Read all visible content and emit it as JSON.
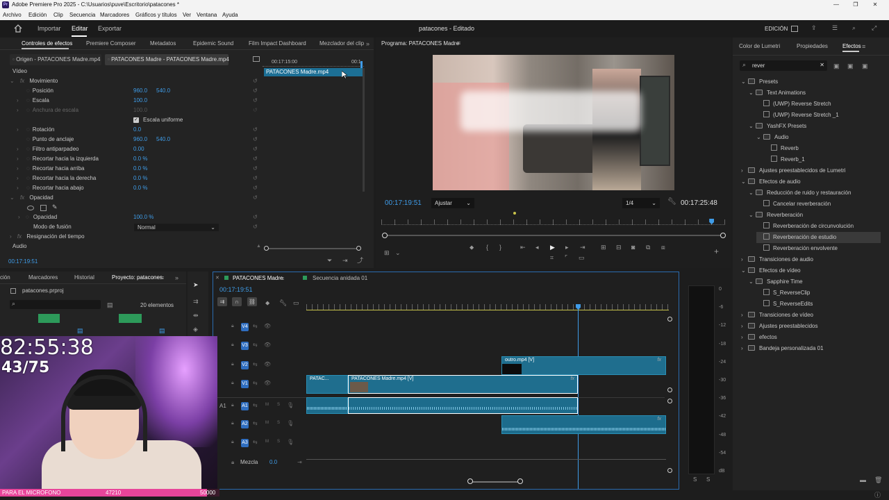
{
  "window": {
    "title": "Adobe Premiere Pro 2025 - C:\\Usuarios\\puve\\Escritorio\\patacones *",
    "controls": [
      "—",
      "❐",
      "✕"
    ]
  },
  "menu": [
    "Archivo",
    "Edición",
    "Clip",
    "Secuencia",
    "Marcadores",
    "Gráficos y títulos",
    "Ver",
    "Ventana",
    "Ayuda"
  ],
  "header": {
    "tabs": [
      "Importar",
      "Editar",
      "Exportar"
    ],
    "active_tab": "Editar",
    "project_title": "patacones - Editado",
    "workspace": "EDICIÓN"
  },
  "effect_controls": {
    "tabs": [
      "Controles de efectos",
      "Premiere Composer",
      "Metadatos",
      "Epidemic Sound",
      "Film Impact Dashboard",
      "Mezclador del clip"
    ],
    "source_tab": "Origen - PATACONES Madre.mp4",
    "clip_tab": "PATACONES Madre - PATACONES Madre.mp4",
    "timecode_ruler": "00:17:15:00",
    "ruler_end": "00:1",
    "clip_label": "PATACONES Madre.mp4",
    "video_header": "Vídeo",
    "movimiento": "Movimiento",
    "props": [
      {
        "name": "Posición",
        "v1": "960.0",
        "v2": "540.0",
        "expand": false
      },
      {
        "name": "Escala",
        "v1": "100.0",
        "v2": "",
        "expand": true
      },
      {
        "name": "Anchura de escala",
        "v1": "100.0",
        "v2": "",
        "expand": true,
        "disabled": true
      },
      {
        "name": "Rotación",
        "v1": "0.0",
        "v2": "",
        "expand": true
      },
      {
        "name": "Punto de anclaje",
        "v1": "960.0",
        "v2": "540.0",
        "expand": false
      },
      {
        "name": "Filtro antiparpadeo",
        "v1": "0.00",
        "v2": "",
        "expand": true
      },
      {
        "name": "Recortar hacia la izquierda",
        "v1": "0.0 %",
        "v2": "",
        "expand": true
      },
      {
        "name": "Recortar hacia arriba",
        "v1": "0.0 %",
        "v2": "",
        "expand": true
      },
      {
        "name": "Recortar hacia la derecha",
        "v1": "0.0 %",
        "v2": "",
        "expand": true
      },
      {
        "name": "Recortar hacia abajo",
        "v1": "0.0 %",
        "v2": "",
        "expand": true
      }
    ],
    "uniform_scale": "Escala uniforme",
    "opacidad_header": "Opacidad",
    "opacidad_label": "Opacidad",
    "opacidad_value": "100.0 %",
    "blend_label": "Modo de fusión",
    "blend_value": "Normal",
    "time_remap": "Resignación del tiempo",
    "audio_header": "Audio",
    "timecode": "00:17:19:51"
  },
  "program": {
    "title": "Programa: PATACONES Madre",
    "timecode": "00:17:19:51",
    "fit": "Ajustar",
    "resolution": "1/4",
    "duration": "00:17:25:48",
    "playhead_pct": 0.96
  },
  "right_panel": {
    "tabs": [
      "Color de Lumetri",
      "Propiedades",
      "Efectos"
    ],
    "search_value": "rever",
    "tree": [
      {
        "depth": 0,
        "type": "folder",
        "open": true,
        "label": "Presets"
      },
      {
        "depth": 1,
        "type": "folder",
        "open": true,
        "label": "Text Animations"
      },
      {
        "depth": 2,
        "type": "preset",
        "label": "(UWP) Reverse Stretch"
      },
      {
        "depth": 2,
        "type": "preset",
        "label": "(UWP) Reverse Stretch _1"
      },
      {
        "depth": 1,
        "type": "folder",
        "open": true,
        "label": "YashFX Presets"
      },
      {
        "depth": 2,
        "type": "folder",
        "open": true,
        "label": "Audio"
      },
      {
        "depth": 3,
        "type": "preset",
        "label": "Reverb"
      },
      {
        "depth": 3,
        "type": "preset",
        "label": "Reverb_1"
      },
      {
        "depth": 0,
        "type": "folder",
        "open": false,
        "label": "Ajustes preestablecidos de Lumetri"
      },
      {
        "depth": 0,
        "type": "folder",
        "open": true,
        "label": "Efectos de audio"
      },
      {
        "depth": 1,
        "type": "folder",
        "open": true,
        "label": "Reducción de ruido y restauración"
      },
      {
        "depth": 2,
        "type": "preset",
        "label": "Cancelar reverberación"
      },
      {
        "depth": 1,
        "type": "folder",
        "open": true,
        "label": "Reverberación"
      },
      {
        "depth": 2,
        "type": "preset",
        "label": "Reverberación de circunvolución"
      },
      {
        "depth": 2,
        "type": "preset",
        "label": "Reverberación de estudio",
        "selected": true
      },
      {
        "depth": 2,
        "type": "preset",
        "label": "Reverberación envolvente"
      },
      {
        "depth": 0,
        "type": "folder",
        "open": false,
        "label": "Transiciones de audio"
      },
      {
        "depth": 0,
        "type": "folder",
        "open": true,
        "label": "Efectos de vídeo"
      },
      {
        "depth": 1,
        "type": "folder",
        "open": true,
        "label": "Sapphire Time"
      },
      {
        "depth": 2,
        "type": "preset",
        "label": "S_ReverseClip"
      },
      {
        "depth": 2,
        "type": "preset",
        "label": "S_ReverseEdits"
      },
      {
        "depth": 0,
        "type": "folder",
        "open": false,
        "label": "Transiciones de vídeo"
      },
      {
        "depth": 0,
        "type": "folder",
        "open": false,
        "label": "Ajustes preestablecidos"
      },
      {
        "depth": 0,
        "type": "folder",
        "open": false,
        "label": "efectos"
      },
      {
        "depth": 0,
        "type": "folder",
        "open": false,
        "label": "Bandeja personalizada 01"
      }
    ]
  },
  "project": {
    "tabs": [
      "ción",
      "Marcadores",
      "Historial",
      "Proyecto: patacones"
    ],
    "file": "patacones.prproj",
    "count": "20 elementos"
  },
  "timeline": {
    "tabs": [
      "PATACONES Madre",
      "Secuencia anidada 01"
    ],
    "timecode": "00:17:19:51",
    "tracks": [
      {
        "name": "V4"
      },
      {
        "name": "V3"
      },
      {
        "name": "V2"
      },
      {
        "name": "V1"
      },
      {
        "name": "A1"
      },
      {
        "name": "A2"
      },
      {
        "name": "A3"
      }
    ],
    "source_label": "A1",
    "mix_label": "Mezcla",
    "mix_value": "0.0",
    "clips": {
      "v2": "outro.mp4 [V]",
      "v1a": "PATAC...",
      "v1b": "PATACONES Madre.mp4 [V]"
    },
    "fx": "fx"
  },
  "meter": {
    "scale": [
      "0",
      "-6",
      "-12",
      "-18",
      "-24",
      "-30",
      "-36",
      "-42",
      "-48",
      "-54",
      "dB"
    ],
    "solo": [
      "S",
      "S"
    ]
  },
  "stream": {
    "timer": "82:55:38",
    "counter": "43/75",
    "bar_label": "PARA EL MICROFONO",
    "bar_value": "47210",
    "bar_goal": "50000",
    "bar_progress": 0.944
  },
  "colors": {
    "accent": "#3f9ce8",
    "clip": "#1f6e8e",
    "track_button": "#2f6ec0",
    "stream_bar": "#e8459a"
  }
}
